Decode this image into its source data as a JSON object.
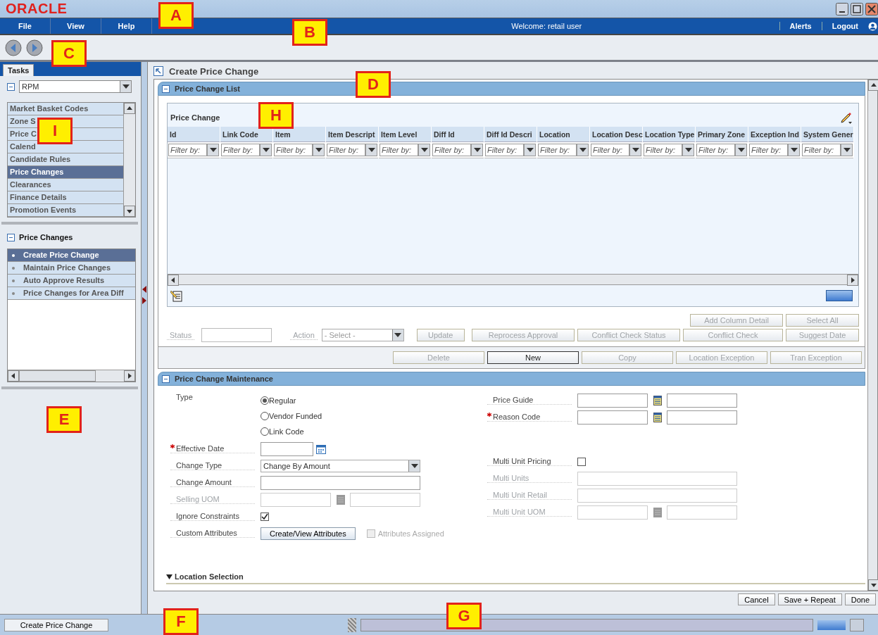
{
  "window": {
    "logo": "ORACLE"
  },
  "menu": {
    "items": [
      "File",
      "View",
      "Help"
    ],
    "welcome": "Welcome: retail user",
    "links": [
      "Alerts",
      "Logout"
    ]
  },
  "tasks": {
    "tab": "Tasks",
    "module": "RPM",
    "items": [
      {
        "label": "Market Basket Codes",
        "selected": false
      },
      {
        "label": "Zone S",
        "selected": false
      },
      {
        "label": "Price C",
        "selected": false
      },
      {
        "label": "Calend",
        "selected": false
      },
      {
        "label": "Candidate Rules",
        "selected": false
      },
      {
        "label": "Price Changes",
        "selected": true
      },
      {
        "label": "Clearances",
        "selected": false
      },
      {
        "label": "Finance Details",
        "selected": false
      },
      {
        "label": "Promotion Events",
        "selected": false
      }
    ]
  },
  "section": {
    "title": "Price Changes",
    "items": [
      {
        "label": "Create Price Change",
        "selected": true
      },
      {
        "label": "Maintain Price Changes",
        "selected": false
      },
      {
        "label": "Auto Approve Results",
        "selected": false
      },
      {
        "label": "Price Changes for Area Diff",
        "selected": false
      }
    ]
  },
  "page": {
    "title": "Create Price Change"
  },
  "list_panel": {
    "title": "Price Change List",
    "table": {
      "title": "Price Change",
      "columns": [
        {
          "label": "Id",
          "placeholder": "Filter by:"
        },
        {
          "label": "Link Code",
          "placeholder": "Filter by:"
        },
        {
          "label": "Item",
          "placeholder": "Filter by:"
        },
        {
          "label": "Item Descript",
          "placeholder": "Filter by:"
        },
        {
          "label": "Item Level",
          "placeholder": "Filter by:"
        },
        {
          "label": "Diff Id",
          "placeholder": "Filter by:"
        },
        {
          "label": "Diff Id Descri",
          "placeholder": "Filter by:"
        },
        {
          "label": "Location",
          "placeholder": "Filter by:"
        },
        {
          "label": "Location Desc",
          "placeholder": "Filter by:"
        },
        {
          "label": "Location Type",
          "placeholder": "Filter by:"
        },
        {
          "label": "Primary Zone",
          "placeholder": "Filter by:"
        },
        {
          "label": "Exception Ind",
          "placeholder": "Filter by:"
        },
        {
          "label": "System Gener",
          "placeholder": "Filter by:"
        }
      ]
    },
    "status_label": "Status",
    "action_label": "Action",
    "action_placeholder": "- Select -",
    "update": {
      "label": "Update",
      "disabled": true
    },
    "buttons_top": [
      {
        "label": "Add Column Detail",
        "disabled": true
      },
      {
        "label": "Select All",
        "disabled": true
      }
    ],
    "buttons_mid": [
      {
        "label": "Reprocess Approval",
        "disabled": true
      },
      {
        "label": "Conflict Check Status",
        "disabled": true
      },
      {
        "label": "Conflict Check",
        "disabled": true
      },
      {
        "label": "Suggest Date",
        "disabled": true
      }
    ],
    "buttons_bottom": [
      {
        "label": "Delete",
        "disabled": true
      },
      {
        "label": "New",
        "disabled": false
      },
      {
        "label": "Copy",
        "disabled": true
      },
      {
        "label": "Location Exception",
        "disabled": true
      },
      {
        "label": "Tran Exception",
        "disabled": true
      }
    ]
  },
  "maintenance": {
    "title": "Price Change Maintenance",
    "type": {
      "label": "Type",
      "options": [
        {
          "label": "Regular",
          "selected": true
        },
        {
          "label": "Vendor Funded",
          "selected": false
        },
        {
          "label": "Link Code",
          "selected": false
        }
      ]
    },
    "left": [
      {
        "kind": "date",
        "label": "Effective Date",
        "required": true,
        "disabled": false
      },
      {
        "kind": "select",
        "label": "Change Type",
        "value": "Change By Amount",
        "disabled": false
      },
      {
        "kind": "text",
        "label": "Change Amount",
        "disabled": false
      },
      {
        "kind": "lookup",
        "label": "Selling UOM",
        "disabled": true
      },
      {
        "kind": "checkbox",
        "label": "Ignore Constraints",
        "checked": true,
        "disabled": false
      },
      {
        "kind": "action",
        "label": "Custom Attributes",
        "button": "Create/View Attributes",
        "extra": "Attributes Assigned",
        "extra_checked": false,
        "disabled": false
      }
    ],
    "right_top": [
      {
        "kind": "lookup",
        "label": "Price Guide",
        "required": false,
        "disabled": false
      },
      {
        "kind": "lookup",
        "label": "Reason Code",
        "required": true,
        "disabled": false
      }
    ],
    "right_bottom": [
      {
        "kind": "checkbox",
        "label": "Multi Unit Pricing",
        "checked": false,
        "disabled": false
      },
      {
        "kind": "text",
        "label": "Multi Units",
        "disabled": true
      },
      {
        "kind": "text",
        "label": "Multi Unit Retail",
        "disabled": true
      },
      {
        "kind": "lookup",
        "label": "Multi Unit UOM",
        "disabled": true
      }
    ],
    "location_selection": {
      "title": "Location Selection",
      "expanded": true
    }
  },
  "footer_buttons": [
    "Cancel",
    "Save + Repeat",
    "Done"
  ],
  "status_bar": {
    "task": "Create Price Change"
  },
  "callouts": [
    "A",
    "B",
    "C",
    "D",
    "E",
    "F",
    "G",
    "H",
    "I"
  ]
}
